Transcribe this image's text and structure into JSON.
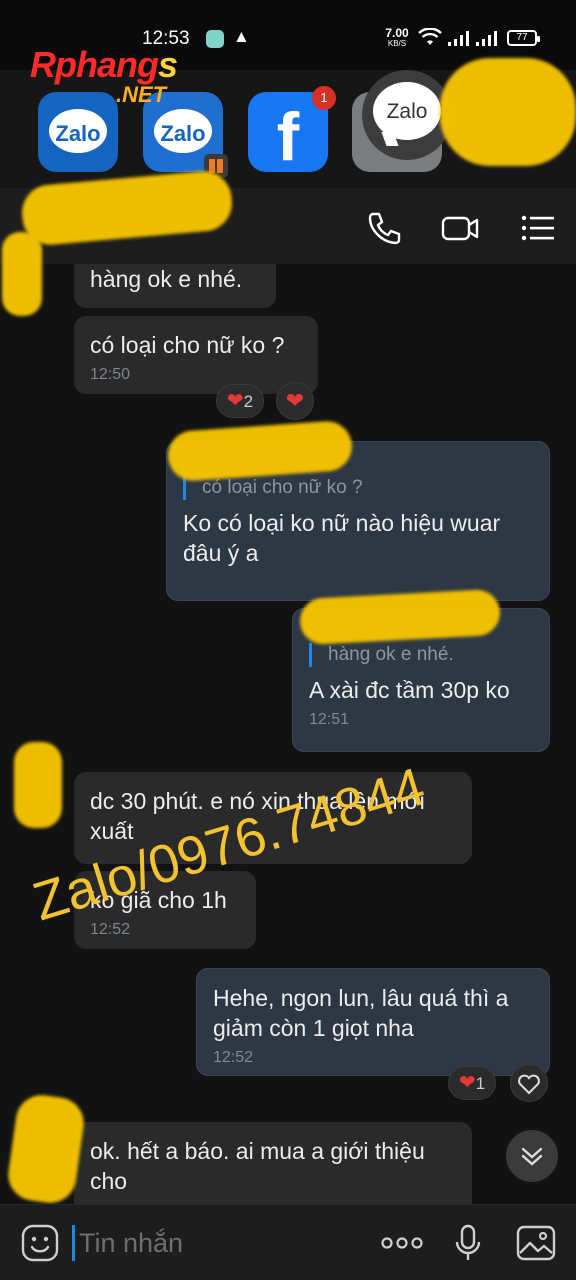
{
  "status_bar": {
    "time": "12:53",
    "net_speed_value": "7.00",
    "net_speed_unit": "KB/S",
    "battery": "77"
  },
  "watermark_logo": {
    "main": "Rphang",
    "accent": "s",
    "domain": ".NET"
  },
  "recent_apps": [
    {
      "name": "Zalo",
      "icon": "zalo-icon"
    },
    {
      "name": "Zalo",
      "icon": "zalo-icon",
      "badge": "dual-app"
    },
    {
      "name": "Facebook",
      "icon": "facebook-icon",
      "badge_count": "1"
    },
    {
      "name": "",
      "icon": "app-icon"
    }
  ],
  "floating_bubble": {
    "label": "Zalo"
  },
  "header": {
    "icons": [
      "phone-icon",
      "video-call-icon",
      "menu-icon"
    ]
  },
  "phone_watermark": "Zalo/0976.74844",
  "messages": [
    {
      "dir": "in",
      "text": "hàng ok e nhé."
    },
    {
      "dir": "in",
      "text": "có loại cho nữ ko ?",
      "time": "12:50",
      "reaction_count": "2"
    },
    {
      "dir": "out",
      "quote": "có loại cho nữ ko ?",
      "text": "Ko có loại ko nữ nào hiệu wuar đâu ý a"
    },
    {
      "dir": "out",
      "quote": "hàng ok e nhé.",
      "text": "A xài đc tầm 30p ko",
      "time": "12:51"
    },
    {
      "dir": "in",
      "text": "dc 30 phút. e nó xin thua lên mới xuất"
    },
    {
      "dir": "in",
      "text": "ko giã cho 1h",
      "time": "12:52"
    },
    {
      "dir": "out",
      "text": "Hehe, ngon lun, lâu quá thì a giảm còn 1 giọt nha",
      "time": "12:52",
      "reaction_count": "1"
    },
    {
      "dir": "in",
      "text": "ok. hết a báo. ai mua a giới thiệu cho"
    }
  ],
  "composer": {
    "placeholder": "Tin nhắn",
    "icons": [
      "emoji-icon",
      "more-icon",
      "microphone-icon",
      "image-icon"
    ]
  },
  "colors": {
    "background": "#121212",
    "incoming_bubble": "#2a2a2a",
    "outgoing_bubble": "#2e3845",
    "accent": "#1e88e5",
    "heart": "#e53935",
    "watermark_yellow": "#f5c400"
  }
}
